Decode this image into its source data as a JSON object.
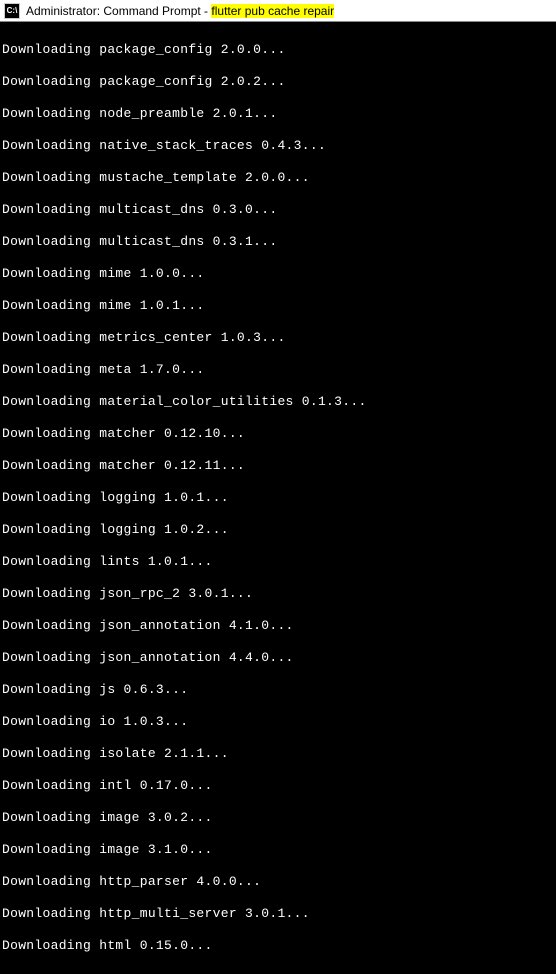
{
  "title": {
    "prefix": "Administrator: Command Prompt - ",
    "command": "flutter  pub cache repair"
  },
  "terminal": {
    "lines": [
      "Downloading package_config 2.0.0...",
      "Downloading package_config 2.0.2...",
      "Downloading node_preamble 2.0.1...",
      "Downloading native_stack_traces 0.4.3...",
      "Downloading mustache_template 2.0.0...",
      "Downloading multicast_dns 0.3.0...",
      "Downloading multicast_dns 0.3.1...",
      "Downloading mime 1.0.0...",
      "Downloading mime 1.0.1...",
      "Downloading metrics_center 1.0.3...",
      "Downloading meta 1.7.0...",
      "Downloading material_color_utilities 0.1.3...",
      "Downloading matcher 0.12.10...",
      "Downloading matcher 0.12.11...",
      "Downloading logging 1.0.1...",
      "Downloading logging 1.0.2...",
      "Downloading lints 1.0.1...",
      "Downloading json_rpc_2 3.0.1...",
      "Downloading json_annotation 4.1.0...",
      "Downloading json_annotation 4.4.0...",
      "Downloading js 0.6.3...",
      "Downloading io 1.0.3...",
      "Downloading isolate 2.1.1...",
      "Downloading intl 0.17.0...",
      "Downloading image 3.0.2...",
      "Downloading image 3.1.0...",
      "Downloading http_parser 4.0.0...",
      "Downloading http_multi_server 3.0.1...",
      "Downloading html 0.15.0..."
    ]
  }
}
